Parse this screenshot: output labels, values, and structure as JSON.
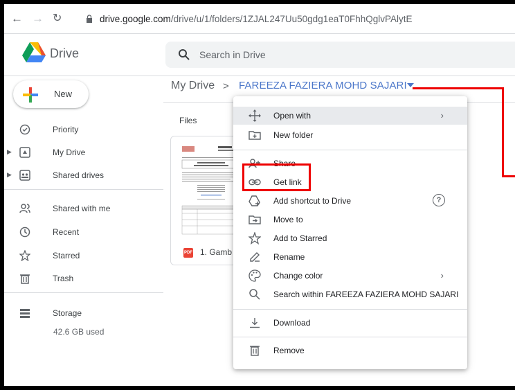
{
  "browser": {
    "url_host": "drive.google.com",
    "url_path": "/drive/u/1/folders/1ZJAL247Uu50gdg1eaT0FhhQglvPAlytE"
  },
  "header": {
    "brand": "Drive",
    "search_placeholder": "Search in Drive"
  },
  "sidebar": {
    "new_label": "New",
    "items": [
      {
        "label": "Priority",
        "icon": "priority-icon"
      },
      {
        "label": "My Drive",
        "icon": "my-drive-icon"
      },
      {
        "label": "Shared drives",
        "icon": "shared-drives-icon"
      },
      {
        "label": "Shared with me",
        "icon": "shared-with-me-icon"
      },
      {
        "label": "Recent",
        "icon": "recent-icon"
      },
      {
        "label": "Starred",
        "icon": "star-icon"
      },
      {
        "label": "Trash",
        "icon": "trash-icon"
      },
      {
        "label": "Storage",
        "icon": "storage-icon"
      }
    ],
    "storage_used": "42.6 GB used"
  },
  "main": {
    "breadcrumb_root": "My Drive",
    "breadcrumb_sep": ">",
    "breadcrumb_folder": "FAREEZA FAZIERA MOHD SAJARI",
    "files_label": "Files",
    "file_name": "1. Gamb",
    "file_type": "PDF"
  },
  "menu": {
    "items": [
      {
        "label": "Open with",
        "icon": "open-with-icon",
        "has_submenu": true
      },
      {
        "label": "New folder",
        "icon": "new-folder-icon"
      },
      {
        "label": "Share",
        "icon": "share-icon"
      },
      {
        "label": "Get link",
        "icon": "link-icon"
      },
      {
        "label": "Add shortcut to Drive",
        "icon": "add-shortcut-icon",
        "help": "?"
      },
      {
        "label": "Move to",
        "icon": "move-to-icon"
      },
      {
        "label": "Add to Starred",
        "icon": "star-outline-icon"
      },
      {
        "label": "Rename",
        "icon": "rename-icon"
      },
      {
        "label": "Change color",
        "icon": "palette-icon",
        "has_submenu": true
      },
      {
        "label": "Search within FAREEZA FAZIERA MOHD SAJARI",
        "icon": "search-icon"
      },
      {
        "label": "Download",
        "icon": "download-icon"
      },
      {
        "label": "Remove",
        "icon": "trash-icon"
      }
    ]
  },
  "colors": {
    "accent": "#4a76c9",
    "annotation": "#e00000",
    "hover": "#e8eaed"
  }
}
